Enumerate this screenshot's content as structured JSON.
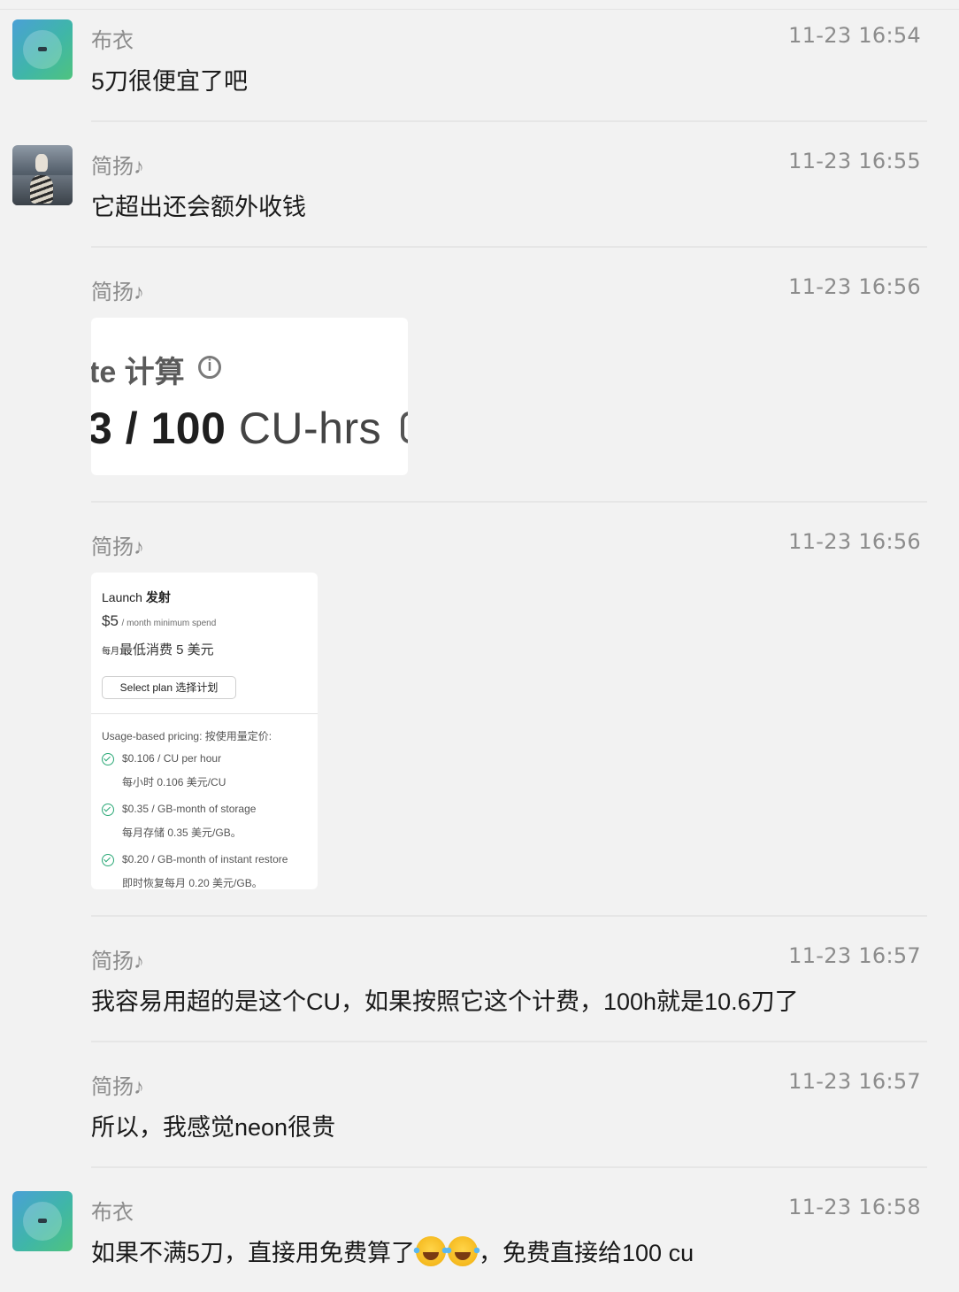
{
  "messages": [
    {
      "sender": "布衣",
      "time": "11-23 16:54",
      "text": "5刀很便宜了吧",
      "avatar": "buyi-avatar"
    },
    {
      "sender": "简扬♪",
      "time": "11-23 16:55",
      "text": "它超出还会额外收钱",
      "avatar": "tiger-avatar"
    },
    {
      "sender": "简扬♪",
      "time": "11-23 16:56",
      "image": {
        "line1": "te  计算",
        "line2_bold": "3 / 100",
        "line2_light": "CU-hrs"
      }
    },
    {
      "sender": "简扬♪",
      "time": "11-23 16:56",
      "image": {
        "title_en": "Launch",
        "title_cn": "发射",
        "price": "$5",
        "price_note": "/ month minimum spend",
        "cn_small": "每月",
        "cn_text": "最低消费 5 美元",
        "button": "Select plan  选择计划",
        "usage_label": "Usage-based pricing:  按使用量定价:",
        "items": [
          {
            "en": "$0.106 / CU per hour",
            "zh": "每小时 0.106 美元/CU"
          },
          {
            "en": "$0.35 / GB-month of storage",
            "zh": "每月存储 0.35 美元/GB。"
          },
          {
            "en": "$0.20 / GB-month of instant restore",
            "zh": "即时恢复每月 0.20 美元/GB。"
          }
        ]
      }
    },
    {
      "sender": "简扬♪",
      "time": "11-23 16:57",
      "text": "我容易用超的是这个CU，如果按照它这个计费，100h就是10.6刀了"
    },
    {
      "sender": "简扬♪",
      "time": "11-23 16:57",
      "text": "所以，我感觉neon很贵"
    },
    {
      "sender": "布衣",
      "time": "11-23 16:58",
      "text_before": "如果不满5刀，直接用免费算了",
      "text_after": "，免费直接给100 cu",
      "emoji": "tears-of-joy-emoji",
      "avatar": "buyi-avatar"
    }
  ]
}
